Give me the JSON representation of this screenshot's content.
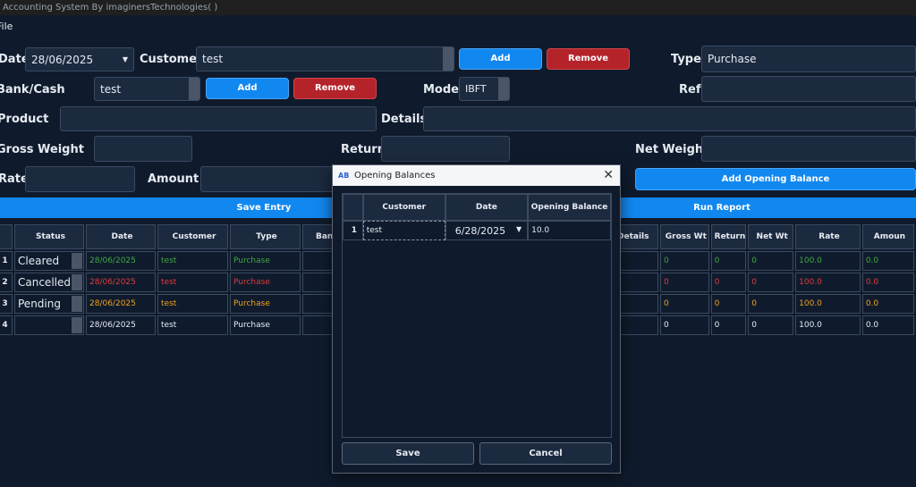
{
  "window": {
    "title": "Accounting System By imaginersTechnologies( )"
  },
  "menu": {
    "file": "File"
  },
  "form": {
    "date_label": "Date",
    "date_value": "28/06/2025",
    "customer_label": "Customer",
    "customer_value": "test",
    "customer_add": "Add",
    "customer_remove": "Remove",
    "type_label": "Type",
    "type_value": "Purchase",
    "bank_label": "Bank/Cash",
    "bank_value": "test",
    "bank_add": "Add",
    "bank_remove": "Remove",
    "mode_label": "Mode",
    "mode_value": "IBFT",
    "ref_label": "Ref",
    "product_label": "Product",
    "details_label": "Details",
    "gross_label": "Gross Weight",
    "return_label": "Return",
    "net_label": "Net Weight",
    "rate_label": "Rate",
    "amount_label": "Amount",
    "add_opening": "Add Opening Balance",
    "save_entry": "Save Entry",
    "run_report": "Run Report"
  },
  "table": {
    "headers_left": [
      "Status",
      "Date",
      "Customer",
      "Type",
      "Bank"
    ],
    "headers_right": [
      "Details",
      "Gross Wt",
      "Return",
      "Net Wt",
      "Rate",
      "Amoun"
    ],
    "rows": [
      {
        "num": "1",
        "status": "Cleared",
        "date": "28/06/2025",
        "customer": "test",
        "type": "Purchase",
        "gross": "0",
        "ret": "0",
        "net": "0",
        "rate": "100.0",
        "amount": "0.0",
        "color": "#3fa83f"
      },
      {
        "num": "2",
        "status": "Cancelled",
        "date": "28/06/2025",
        "customer": "test",
        "type": "Purchase",
        "gross": "0",
        "ret": "0",
        "net": "0",
        "rate": "100.0",
        "amount": "0.0",
        "color": "#e03a3a"
      },
      {
        "num": "3",
        "status": "Pending",
        "date": "28/06/2025",
        "customer": "test",
        "type": "Purchase",
        "gross": "0",
        "ret": "0",
        "net": "0",
        "rate": "100.0",
        "amount": "0.0",
        "color": "#f0a21a"
      },
      {
        "num": "4",
        "status": "",
        "date": "28/06/2025",
        "customer": "test",
        "type": "Purchase",
        "gross": "0",
        "ret": "0",
        "net": "0",
        "rate": "100.0",
        "amount": "0.0",
        "color": "#e6ebf2"
      }
    ]
  },
  "dialog": {
    "title": "Opening Balances",
    "logo": "AB",
    "headers": [
      "Customer",
      "Date",
      "Opening Balance"
    ],
    "row": {
      "num": "1",
      "customer": "test",
      "date": "6/28/2025",
      "balance": "10.0"
    },
    "save": "Save",
    "cancel": "Cancel"
  }
}
